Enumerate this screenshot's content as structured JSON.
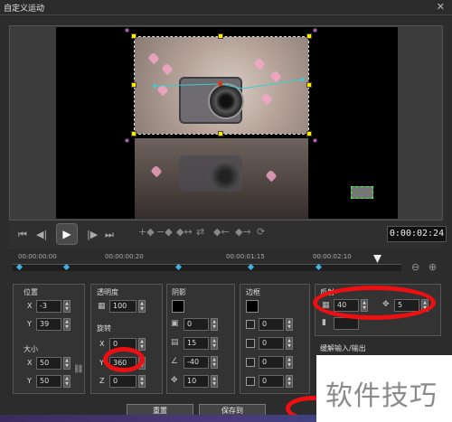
{
  "window": {
    "title": "自定义运动",
    "close": "✕"
  },
  "transport": {
    "buttons": [
      "⏮",
      "◀|",
      "▶",
      "|▶",
      "⏭"
    ],
    "keyframe_tools": [
      "+◆",
      "−◆",
      "◆↔",
      "⇄",
      "◆←",
      "◆→",
      "⟳"
    ],
    "timecode": "0:00:02:24"
  },
  "timeline": {
    "ticks": [
      "00:00:00:00",
      "00:00:00:20",
      "00:00:01:15",
      "00:00:02:10"
    ],
    "playhead": "◆",
    "zoom_out": "⊖",
    "zoom_in": "⊕"
  },
  "position": {
    "title": "位置",
    "x_label": "X",
    "x": "-3",
    "y_label": "Y",
    "y": "39"
  },
  "size": {
    "title": "大小",
    "x_label": "X",
    "x": "50",
    "y_label": "Y",
    "y": "50"
  },
  "opacity": {
    "title": "透明度",
    "value": "100"
  },
  "rotation": {
    "title": "旋转",
    "x_label": "X",
    "x": "0",
    "y_label": "Y",
    "y": "360",
    "z_label": "Z",
    "z": "0"
  },
  "shadow": {
    "title": "阴影",
    "v1": "0",
    "v2": "15",
    "v3": "-40",
    "v4": "10"
  },
  "border": {
    "title": "边框",
    "v1": "0",
    "v2": "0",
    "v3": "0",
    "v4": "0"
  },
  "reflection": {
    "title": "反射",
    "v1": "40",
    "v2": "5"
  },
  "fade": {
    "title": "缓解输入/输出"
  },
  "buttons": {
    "reset": "重置",
    "save": "保存到"
  },
  "watermark": "软件技巧"
}
